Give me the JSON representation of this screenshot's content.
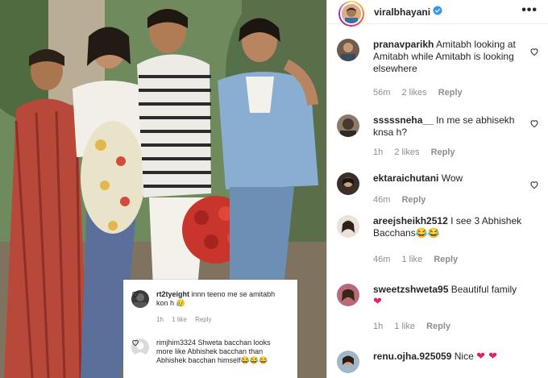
{
  "post": {
    "username": "viralbhayani",
    "more_label": "•••"
  },
  "photo_inset": {
    "comments": [
      {
        "user": "rt2tyeight",
        "text": "innn teeno me se amitabh kon h 😥",
        "time": "1h",
        "likes": "1 like",
        "reply": "Reply"
      },
      {
        "user": "rimjhim3324",
        "text": "Shweta bacchan looks more like Abhishek bacchan than Abhishek bacchan himself😂😂😂",
        "time": "",
        "likes": "",
        "reply": ""
      }
    ]
  },
  "comments": [
    {
      "user": "pranavparikh",
      "text": "Amitabh looking at Amitabh while Amitabh is looking elsewhere",
      "time": "56m",
      "likes": "2 likes",
      "reply": "Reply"
    },
    {
      "user": "sssssneha__",
      "text": "In me se abhisekh knsa h?",
      "time": "1h",
      "likes": "2 likes",
      "reply": "Reply"
    },
    {
      "user": "ektaraichutani",
      "text": "Wow",
      "time": "46m",
      "likes": "",
      "reply": "Reply"
    },
    {
      "user": "areejsheikh2512",
      "text": "I see 3 Abhishek Bacchans😂😂",
      "time": "46m",
      "likes": "1 like",
      "reply": "Reply"
    },
    {
      "user": "sweetzshweta95",
      "text": "Beautiful family",
      "emoji": "❤",
      "time": "1h",
      "likes": "1 like",
      "reply": "Reply"
    },
    {
      "user": "renu.ojha.925059",
      "text": "Nice",
      "emoji": "❤ ❤",
      "time": "",
      "likes": "",
      "reply": ""
    }
  ],
  "colors": {
    "verified": "#3897f0",
    "meta": "#8e8e8e",
    "heart": "#e0245e"
  }
}
